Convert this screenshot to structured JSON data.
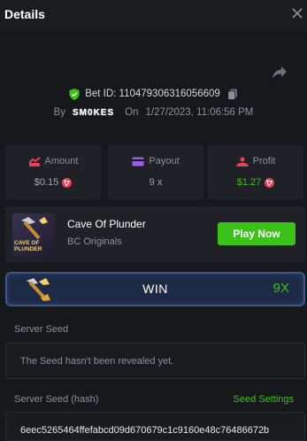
{
  "header": {
    "title": "Details"
  },
  "bet": {
    "id_text": "Bet ID: 110479306316056609",
    "by_label": "By",
    "username": "SM0KES",
    "on_label": "On",
    "datetime": "1/27/2023, 11:06:56 PM"
  },
  "stats": {
    "amount": {
      "label": "Amount",
      "value": "$0.15"
    },
    "payout": {
      "label": "Payout",
      "value": "9 x"
    },
    "profit": {
      "label": "Profit",
      "value": "$1.27"
    }
  },
  "game": {
    "name": "Cave Of Plunder",
    "provider": "BC Originals",
    "thumb_caption": "CAVE OF PLUNDER",
    "play_label": "Play Now"
  },
  "result": {
    "label": "WIN",
    "multiplier": "9X"
  },
  "seeds": {
    "server_seed_label": "Server Seed",
    "server_seed_text": "The Seed hasn't been revealed yet.",
    "hash_label": "Server Seed (hash)",
    "seed_settings_label": "Seed Settings",
    "hash_value": "6eec5265464ffefabcd09d670679c1c9160e48c76486672b"
  },
  "colors": {
    "accent_green": "#3bc117",
    "coin_red": "#e8415a",
    "background": "#17181b",
    "card": "#202126"
  },
  "icons": [
    "close-icon",
    "share-icon",
    "shield-check-icon",
    "copy-icon",
    "amount-icon",
    "payout-icon",
    "profit-icon",
    "trx-coin-icon",
    "pickaxe-icon"
  ]
}
